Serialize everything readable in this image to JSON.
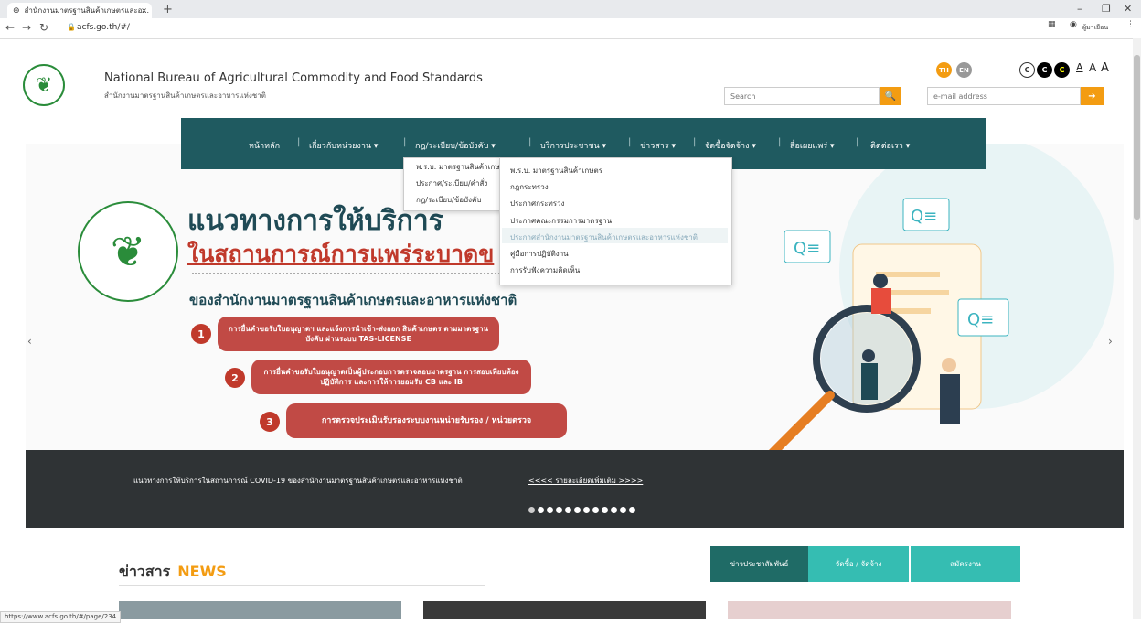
{
  "browser": {
    "tab_title": "สำนักงานมาตรฐานสินค้าเกษตรและอ...",
    "tab_close": "×",
    "new_tab": "+",
    "url": "acfs.go.th/#/",
    "profile_label": "ผู้มาเยือน",
    "status_url": "https://www.acfs.go.th/#/page/234"
  },
  "header": {
    "title": "National Bureau of Agricultural Commodity and Food Standards",
    "subtitle": "สำนักงานมาตรฐานสินค้าเกษตรและอาหารแห่งชาติ",
    "lang_th": "TH",
    "lang_en": "EN",
    "contrast_1": "C",
    "contrast_2": "C",
    "contrast_3": "C",
    "font_small": "A",
    "font_medium": "A",
    "font_large": "A",
    "search_placeholder": "Search",
    "email_placeholder": "e-mail address"
  },
  "nav": {
    "items": [
      "หน้าหลัก",
      "เกี่ยวกับหน่วยงาน ▾",
      "กฎ/ระเบียบ/ข้อบังคับ ▾",
      "บริการประชาชน ▾",
      "ข่าวสาร ▾",
      "จัดซื้อจัดจ้าง ▾",
      "สื่อเผยแพร่ ▾",
      "ติดต่อเรา ▾"
    ]
  },
  "submenu_level1": [
    "พ.ร.บ. มาตรฐานสินค้าเกษตร",
    "ประกาศ/ระเบียบ/คำสั่ง",
    "กฎ/ระเบียบ/ข้อบังคับ"
  ],
  "submenu_level2": [
    "พ.ร.บ. มาตรฐานสินค้าเกษตร",
    "กฎกระทรวง",
    "ประกาศกระทรวง",
    "ประกาศคณะกรรมการมาตรฐาน",
    "ประกาศสำนักงานมาตรฐานสินค้าเกษตรและอาหารแห่งชาติ",
    "คู่มือการปฏิบัติงาน",
    "การรับฟังความคิดเห็น"
  ],
  "banner": {
    "heading_1": "แนวทางการให้บริการ",
    "heading_2": "ในสถานการณ์การแพร่ระบาดข",
    "heading_3": "ของสำนักงานมาตรฐานสินค้าเกษตรและอาหารแห่งชาติ",
    "seal_text": "สำนักงานมาตรฐานสินค้าเกษตรและอาหารแห่งชาติ",
    "steps": [
      {
        "num": "1",
        "text": "การยื่นคำขอรับใบอนุญาตฯ และแจ้งการนำเข้า-ส่งออก สินค้าเกษตร ตามมาตรฐานบังคับ ผ่านระบบ TAS-LICENSE"
      },
      {
        "num": "2",
        "text": "การยื่นคำขอรับใบอนุญาตเป็นผู้ประกอบการตรวจสอบมาตรฐาน การสอบเทียบห้องปฏิบัติการ และการให้การยอมรับ CB และ IB"
      },
      {
        "num": "3",
        "text": "การตรวจประเมินรับรองระบบงานหน่วยรับรอง / หน่วยตรวจ"
      }
    ],
    "ticker_text": "แนวทางการให้บริการในสถานการณ์ COVID-19 ของสำนักงานมาตรฐานสินค้าเกษตรและอาหารแห่งชาติ",
    "ticker_link": "<<<<  รายละเอียดเพิ่มเติม  >>>>",
    "prev": "‹",
    "next": "›"
  },
  "news": {
    "title_th": "ข่าวสาร",
    "title_en": "NEWS",
    "tabs": [
      "ข่าวประชาสัมพันธ์",
      "จัดซื้อ / จัดจ้าง",
      "สมัครงาน"
    ]
  },
  "colors": {
    "nav_bg": "#1f5a60",
    "accent_orange": "#f39c12",
    "banner_red": "#c0392b",
    "news_tab_dark": "#1f6b66",
    "news_tab_light": "#35bdb2"
  }
}
